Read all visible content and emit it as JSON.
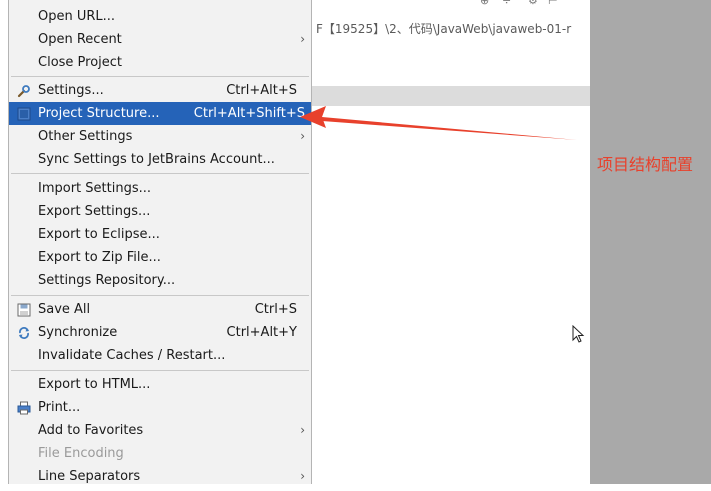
{
  "background": {
    "path_text": "F【19525】\\2、代码\\JavaWeb\\javaweb-01-r"
  },
  "menu": {
    "items": [
      {
        "label": "Open URL...",
        "shortcut": "",
        "submenu": false
      },
      {
        "label": "Open Recent",
        "shortcut": "",
        "submenu": true
      },
      {
        "label": "Close Project",
        "shortcut": "",
        "submenu": false
      },
      {
        "label": "Settings...",
        "shortcut": "Ctrl+Alt+S",
        "submenu": false,
        "icon": "wrench-icon"
      },
      {
        "label": "Project Structure...",
        "shortcut": "Ctrl+Alt+Shift+S",
        "submenu": false,
        "icon": "project-structure-icon",
        "highlighted": true
      },
      {
        "label": "Other Settings",
        "shortcut": "",
        "submenu": true
      },
      {
        "label": "Sync Settings to JetBrains Account...",
        "shortcut": "",
        "submenu": false
      },
      {
        "label": "Import Settings...",
        "shortcut": "",
        "submenu": false
      },
      {
        "label": "Export Settings...",
        "shortcut": "",
        "submenu": false
      },
      {
        "label": "Export to Eclipse...",
        "shortcut": "",
        "submenu": false
      },
      {
        "label": "Export to Zip File...",
        "shortcut": "",
        "submenu": false
      },
      {
        "label": "Settings Repository...",
        "shortcut": "",
        "submenu": false
      },
      {
        "label": "Save All",
        "shortcut": "Ctrl+S",
        "submenu": false,
        "icon": "save-icon"
      },
      {
        "label": "Synchronize",
        "shortcut": "Ctrl+Alt+Y",
        "submenu": false,
        "icon": "sync-icon"
      },
      {
        "label": "Invalidate Caches / Restart...",
        "shortcut": "",
        "submenu": false
      },
      {
        "label": "Export to HTML...",
        "shortcut": "",
        "submenu": false
      },
      {
        "label": "Print...",
        "shortcut": "",
        "submenu": false,
        "icon": "printer-icon"
      },
      {
        "label": "Add to Favorites",
        "shortcut": "",
        "submenu": true
      },
      {
        "label": "File Encoding",
        "shortcut": "",
        "submenu": false,
        "disabled": true
      },
      {
        "label": "Line Separators",
        "shortcut": "",
        "submenu": true
      }
    ],
    "submenu_arrow": "›"
  },
  "annotation": {
    "text": "项目结构配置",
    "color": "#e8412c"
  },
  "colors": {
    "highlight": "#2563b8",
    "menu_bg": "#f2f2f2"
  }
}
